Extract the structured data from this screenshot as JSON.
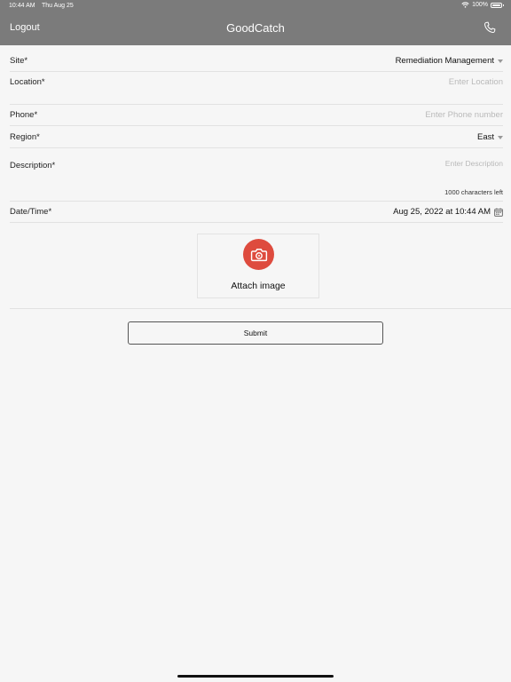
{
  "status_bar": {
    "time": "10:44 AM",
    "date": "Thu Aug 25",
    "battery": "100%"
  },
  "nav": {
    "left_button": "Logout",
    "title": "GoodCatch",
    "right_icon": "phone-icon"
  },
  "form": {
    "site": {
      "label": "Site*",
      "value": "Remediation Management"
    },
    "location": {
      "label": "Location*",
      "placeholder": "Enter Location"
    },
    "phone": {
      "label": "Phone*",
      "placeholder": "Enter Phone number"
    },
    "region": {
      "label": "Region*",
      "value": "East"
    },
    "description": {
      "label": "Description*",
      "placeholder": "Enter Description",
      "counter": "1000 characters left"
    },
    "datetime": {
      "label": "Date/Time*",
      "value": "Aug 25, 2022 at 10:44 AM"
    }
  },
  "attach": {
    "label": "Attach image",
    "icon": "camera-icon",
    "color": "#de4b3e"
  },
  "submit_label": "Submit",
  "colors": {
    "nav_bar": "#7b7b7b",
    "background": "#f6f6f6"
  }
}
